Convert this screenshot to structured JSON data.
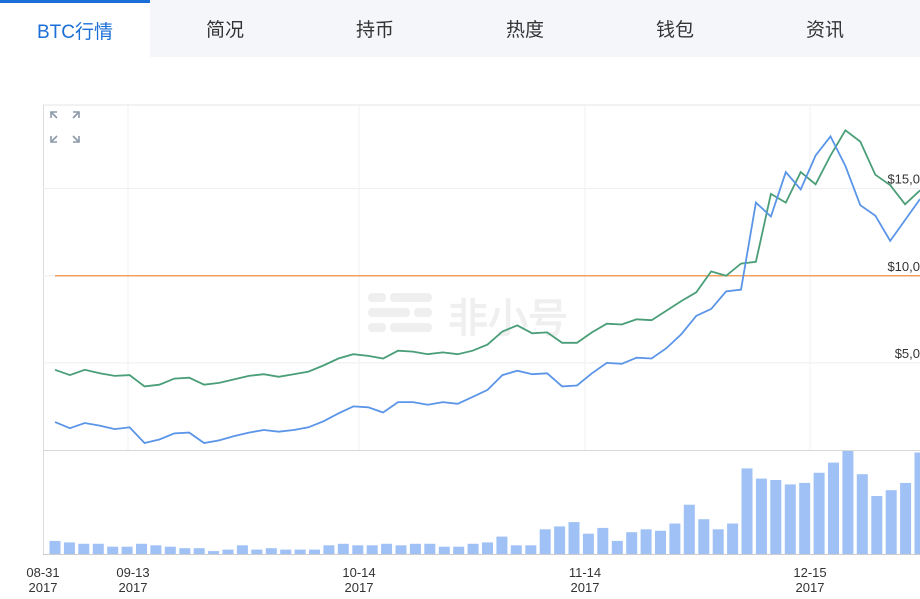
{
  "tabs": [
    {
      "label": "BTC行情",
      "active": true
    },
    {
      "label": "简况"
    },
    {
      "label": "持币"
    },
    {
      "label": "热度"
    },
    {
      "label": "钱包"
    },
    {
      "label": "资讯"
    }
  ],
  "watermark": "非小号",
  "colors": {
    "accent": "#1b6fd6",
    "series_upper": "#4a9e78",
    "series_lower": "#5b95e8",
    "volume_bar": "#9fc1f5",
    "reference_line": "#f0a060"
  },
  "chart_data": {
    "type": "line",
    "x_type": "date",
    "x": [
      "2017-08-31",
      "2017-09-03",
      "2017-09-06",
      "2017-09-09",
      "2017-09-11",
      "2017-09-13",
      "2017-09-15",
      "2017-09-18",
      "2017-09-20",
      "2017-09-23",
      "2017-09-26",
      "2017-09-28",
      "2017-10-01",
      "2017-10-03",
      "2017-10-06",
      "2017-10-08",
      "2017-10-11",
      "2017-10-14",
      "2017-10-16",
      "2017-10-19",
      "2017-10-21",
      "2017-10-24",
      "2017-10-26",
      "2017-10-29",
      "2017-10-31",
      "2017-11-03",
      "2017-11-05",
      "2017-11-08",
      "2017-11-11",
      "2017-11-14",
      "2017-11-16",
      "2017-11-19",
      "2017-11-21",
      "2017-11-24",
      "2017-11-26",
      "2017-11-29",
      "2017-12-01",
      "2017-12-04",
      "2017-12-07",
      "2017-12-09",
      "2017-12-12",
      "2017-12-15",
      "2017-12-17",
      "2017-12-20",
      "2017-12-22",
      "2017-12-25",
      "2017-12-27"
    ],
    "x_tick_labels": [
      {
        "day": "08-31",
        "year": "2017"
      },
      {
        "day": "09-13",
        "year": "2017"
      },
      {
        "day": "10-14",
        "year": "2017"
      },
      {
        "day": "11-14",
        "year": "2017"
      },
      {
        "day": "12-15",
        "year": "2017"
      }
    ],
    "y_tick_labels": [
      "$15,0",
      "$10,0",
      "$5,0"
    ],
    "y_ticks": [
      15000,
      10000,
      5000
    ],
    "ylim": [
      0,
      19800
    ],
    "reference_value": 10000,
    "series": [
      {
        "values": [
          4600,
          4300,
          4600,
          4400,
          4250,
          4300,
          3650,
          3750,
          4100,
          4150,
          3750,
          3850,
          4050,
          4250,
          4350,
          4200,
          4350,
          4500,
          4850,
          5250,
          5500,
          5400,
          5250,
          5700,
          5650,
          5500,
          5600,
          5500,
          5700,
          6050,
          6800,
          7150,
          6700,
          6750,
          6150,
          6150,
          6750,
          7250,
          7200,
          7500,
          7450,
          8000,
          8550,
          9050,
          10250,
          10000,
          10700,
          10800,
          14700,
          14200,
          15950,
          15250,
          16900,
          18350,
          17700,
          15800,
          15200,
          14100,
          14900
        ]
      },
      {
        "values": [
          1600,
          1250,
          1550,
          1400,
          1200,
          1300,
          400,
          600,
          950,
          1000,
          400,
          550,
          800,
          1000,
          1150,
          1050,
          1150,
          1300,
          1650,
          2100,
          2500,
          2450,
          2150,
          2750,
          2750,
          2600,
          2750,
          2650,
          3050,
          3450,
          4300,
          4550,
          4350,
          4400,
          3650,
          3700,
          4400,
          5000,
          4950,
          5300,
          5250,
          5850,
          6650,
          7700,
          8100,
          9100,
          9200,
          14200,
          13400,
          15950,
          14950,
          16900,
          18000,
          16300,
          14050,
          13450,
          12000,
          13200,
          14400
        ]
      }
    ],
    "volume": [
      9,
      8,
      7,
      7,
      5,
      5,
      7,
      6,
      5,
      4,
      4,
      2,
      3,
      6,
      3,
      4,
      3,
      3,
      3,
      6,
      7,
      6,
      6,
      7,
      6,
      7,
      7,
      5,
      5,
      7,
      8,
      12,
      6,
      6,
      17,
      19,
      22,
      14,
      18,
      9,
      15,
      17,
      16,
      21,
      34,
      24,
      17,
      21,
      59,
      52,
      51,
      48,
      49,
      56,
      63,
      71,
      55,
      40,
      44,
      49,
      70
    ],
    "grid": true
  }
}
